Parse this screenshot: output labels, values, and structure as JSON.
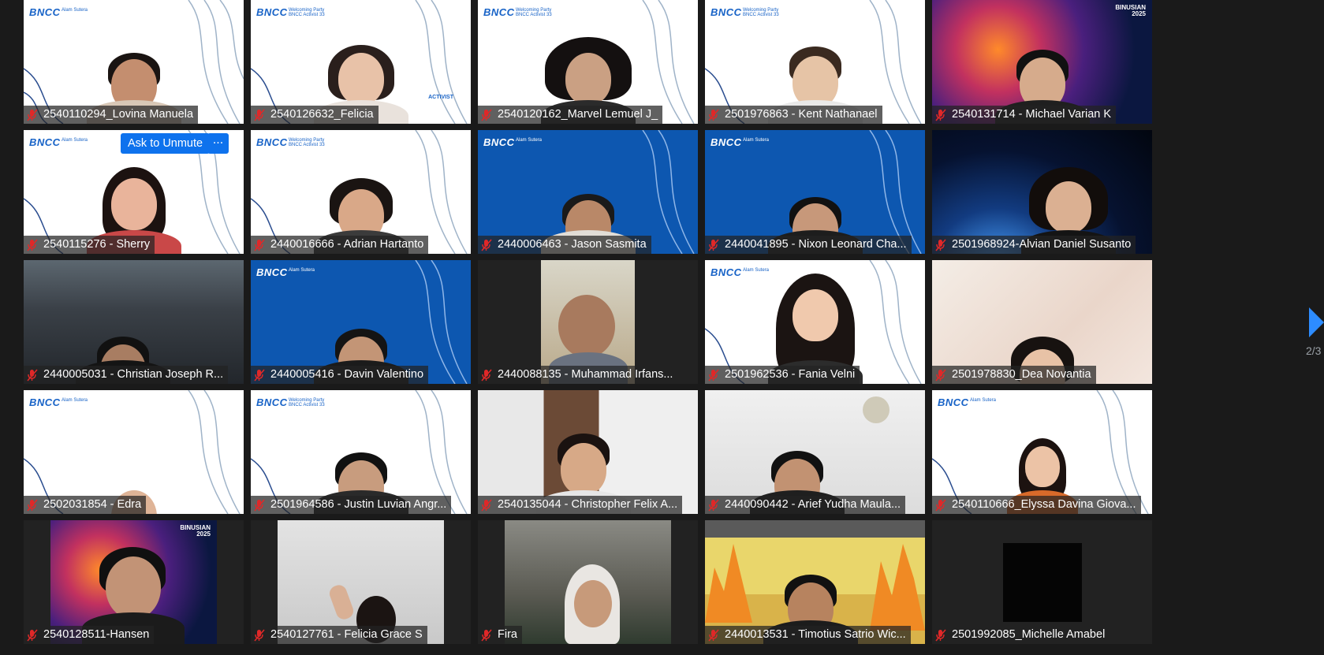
{
  "colors": {
    "accent": "#0e72ed",
    "mute": "#e02828",
    "tile_label_bg": "#232323",
    "arrow": "#2d8cff"
  },
  "tile_overlay": {
    "ask_to_unmute": "Ask to Unmute",
    "more": "···"
  },
  "pagination": {
    "indicator": "2/3"
  },
  "backgrounds": {
    "logo": "BNCC",
    "logo_sub": "Alam Sutera",
    "logo_sub_party": "Welcoming Party BNCC Activist 33",
    "activist": "ACTIVIST",
    "binusian": "BINUSIAN 2025"
  },
  "participants": [
    {
      "name": "2540110294_Lovina Manuela",
      "bg": "white",
      "muted": true
    },
    {
      "name": "2540126632_Felicia",
      "bg": "white-party",
      "muted": true
    },
    {
      "name": "2540120162_Marvel Lemuel J_",
      "bg": "white-party",
      "muted": true
    },
    {
      "name": "2501976863 - Kent Nathanael",
      "bg": "white-party",
      "muted": true
    },
    {
      "name": "2540131714 - Michael Varian K",
      "bg": "space",
      "muted": true
    },
    {
      "name": "2540115276 - Sherry",
      "bg": "white",
      "muted": true
    },
    {
      "name": "2440016666 - Adrian Hartanto",
      "bg": "white-party",
      "muted": true
    },
    {
      "name": "2440006463 - Jason Sasmita",
      "bg": "blue",
      "muted": true
    },
    {
      "name": "2440041895 - Nixon Leonard Cha...",
      "bg": "blue",
      "muted": true
    },
    {
      "name": "2501968924-Alvian Daniel Susanto",
      "bg": "earth",
      "muted": true
    },
    {
      "name": "2440005031 - Christian Joseph R...",
      "bg": "dark",
      "muted": true
    },
    {
      "name": "2440005416 - Davin Valentino",
      "bg": "blue",
      "muted": true
    },
    {
      "name": "2440088135 - Muhammad Irfans...",
      "bg": "room",
      "muted": true
    },
    {
      "name": "2501962536 - Fania Velni",
      "bg": "white",
      "muted": true
    },
    {
      "name": "2501978830_Dea Novantia",
      "bg": "beige",
      "muted": true
    },
    {
      "name": "2502031854 - Edra",
      "bg": "white",
      "muted": true
    },
    {
      "name": "2501964586 - Justin Luvian Angr...",
      "bg": "white-party",
      "muted": true
    },
    {
      "name": "2540135044 - Christopher Felix A...",
      "bg": "room",
      "muted": true
    },
    {
      "name": "2440090442 - Arief Yudha Maula...",
      "bg": "room2",
      "muted": true
    },
    {
      "name": "2540110666_Elyssa Davina Giova...",
      "bg": "white",
      "muted": true
    },
    {
      "name": "2540128511-Hansen",
      "bg": "space",
      "muted": true
    },
    {
      "name": "2540127761 - Felicia Grace S",
      "bg": "room2",
      "muted": true
    },
    {
      "name": "Fira",
      "bg": "room2",
      "muted": true
    },
    {
      "name": "2440013531 - Timotius Satrio Wic...",
      "bg": "cartoon",
      "muted": true
    },
    {
      "name": "2501992085_Michelle Amabel",
      "bg": "black",
      "muted": true
    }
  ]
}
